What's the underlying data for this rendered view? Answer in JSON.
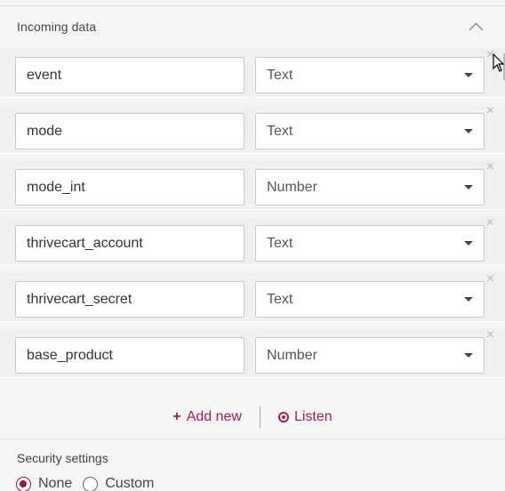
{
  "incoming": {
    "title": "Incoming data",
    "fields": [
      {
        "name": "event",
        "type": "Text"
      },
      {
        "name": "mode",
        "type": "Text"
      },
      {
        "name": "mode_int",
        "type": "Number"
      },
      {
        "name": "thrivecart_account",
        "type": "Text"
      },
      {
        "name": "thrivecart_secret",
        "type": "Text"
      },
      {
        "name": "base_product",
        "type": "Number"
      }
    ],
    "remove_glyph": "×"
  },
  "actions": {
    "add_new_label": "Add new",
    "listen_label": "Listen"
  },
  "security": {
    "title": "Security settings",
    "options": [
      {
        "label": "None",
        "selected": true
      },
      {
        "label": "Custom",
        "selected": false
      }
    ]
  },
  "colors": {
    "accent": "#9b1f5c",
    "background": "#f5f5f6"
  }
}
